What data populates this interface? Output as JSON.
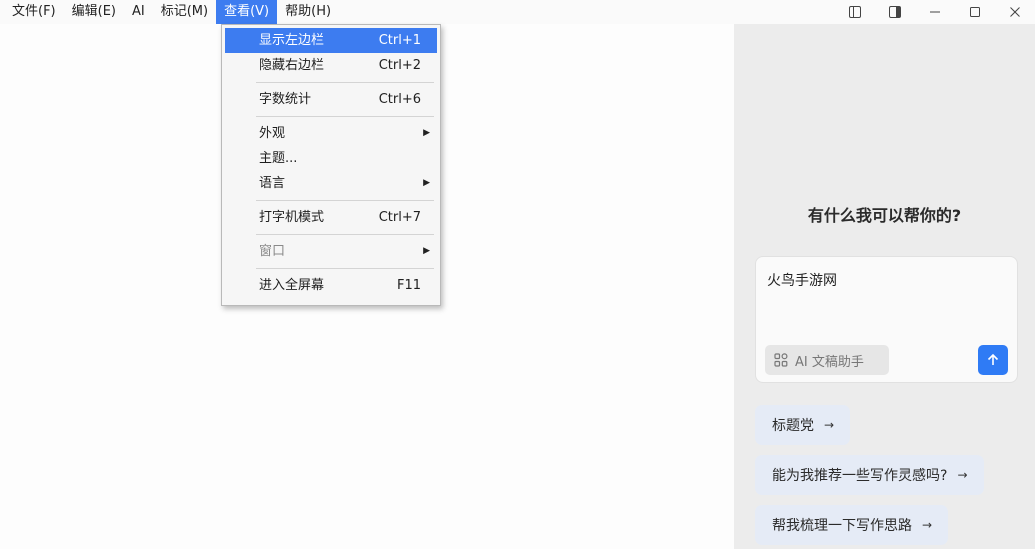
{
  "menubar": {
    "items": [
      "文件(F)",
      "编辑(E)",
      "AI",
      "标记(M)",
      "查看(V)",
      "帮助(H)"
    ]
  },
  "window_controls": [
    "toggle-left-sidebar-icon",
    "toggle-right-sidebar-icon",
    "minimize-icon",
    "maximize-icon",
    "close-icon"
  ],
  "view_menu": {
    "items": [
      {
        "label": "显示左边栏",
        "shortcut": "Ctrl+1"
      },
      {
        "label": "隐藏右边栏",
        "shortcut": "Ctrl+2"
      },
      {
        "label": "字数统计",
        "shortcut": "Ctrl+6"
      },
      {
        "label": "外观",
        "shortcut": ""
      },
      {
        "label": "主题...",
        "shortcut": ""
      },
      {
        "label": "语言",
        "shortcut": ""
      },
      {
        "label": "打字机模式",
        "shortcut": "Ctrl+7"
      },
      {
        "label": "窗口",
        "shortcut": ""
      },
      {
        "label": "进入全屏幕",
        "shortcut": "F11"
      }
    ]
  },
  "panel": {
    "title": "有什么我可以帮你的?",
    "input_value": "火鸟手游网",
    "assist_label": "AI 文稿助手",
    "suggestions": [
      "标题党",
      "能为我推荐一些写作灵感吗?",
      "帮我梳理一下写作思路"
    ]
  },
  "colors": {
    "accent": "#3d7cf0",
    "send_button": "#2f7bf5",
    "panel_bg": "#ececec",
    "suggestion_bg": "#e5ebf6"
  }
}
